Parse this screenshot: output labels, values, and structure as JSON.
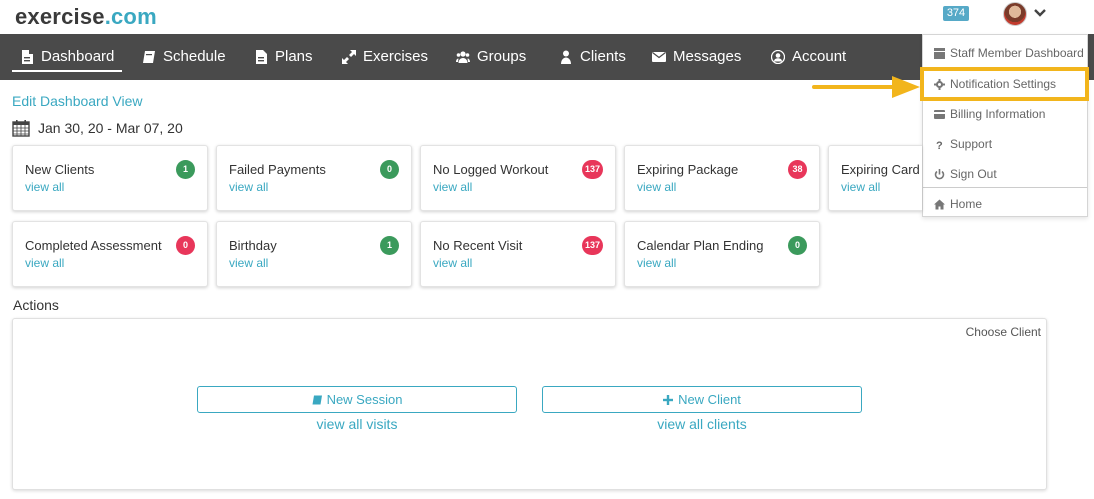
{
  "logo": {
    "part1": "exercise",
    "part2": ".com"
  },
  "header": {
    "notification_count": "374"
  },
  "nav": {
    "items": [
      {
        "label": "Dashboard"
      },
      {
        "label": "Schedule"
      },
      {
        "label": "Plans"
      },
      {
        "label": "Exercises"
      },
      {
        "label": "Groups"
      },
      {
        "label": "Clients"
      },
      {
        "label": "Messages"
      },
      {
        "label": "Account"
      }
    ]
  },
  "dropdown": {
    "items": [
      {
        "label": "Staff Member Dashboard",
        "icon": "dashboard-icon"
      },
      {
        "label": "Notification Settings",
        "icon": "gear-icon"
      },
      {
        "label": "Billing Information",
        "icon": "credit-card-icon"
      },
      {
        "label": "Support",
        "icon": "question-icon"
      },
      {
        "label": "Sign Out",
        "icon": "power-icon"
      },
      {
        "label": "Home",
        "icon": "home-icon"
      }
    ]
  },
  "dashboard": {
    "edit_link": "Edit Dashboard View",
    "date_range": "Jan 30, 20 - Mar 07, 20",
    "view_all": "view all",
    "cards": [
      {
        "title": "New Clients",
        "count": "1",
        "status": "green"
      },
      {
        "title": "Failed Payments",
        "count": "0",
        "status": "green"
      },
      {
        "title": "No Logged Workout",
        "count": "137",
        "status": "red"
      },
      {
        "title": "Expiring Package",
        "count": "38",
        "status": "red"
      },
      {
        "title": "Expiring Card",
        "count": "",
        "status": "none"
      },
      {
        "title": "Completed Assessment",
        "count": "0",
        "status": "red"
      },
      {
        "title": "Birthday",
        "count": "1",
        "status": "green"
      },
      {
        "title": "No Recent Visit",
        "count": "137",
        "status": "red"
      },
      {
        "title": "Calendar Plan Ending",
        "count": "0",
        "status": "green"
      }
    ]
  },
  "actions": {
    "label": "Actions",
    "choose_client": "Choose Client",
    "new_session": "New Session",
    "new_client": "New Client",
    "view_all_visits": "view all visits",
    "view_all_clients": "view all clients"
  },
  "colors": {
    "accent": "#3aa8c1",
    "nav_bg": "#4a4a4a",
    "badge_green": "#3b9a5c",
    "badge_red": "#e8365a",
    "highlight": "#f2b51c"
  }
}
